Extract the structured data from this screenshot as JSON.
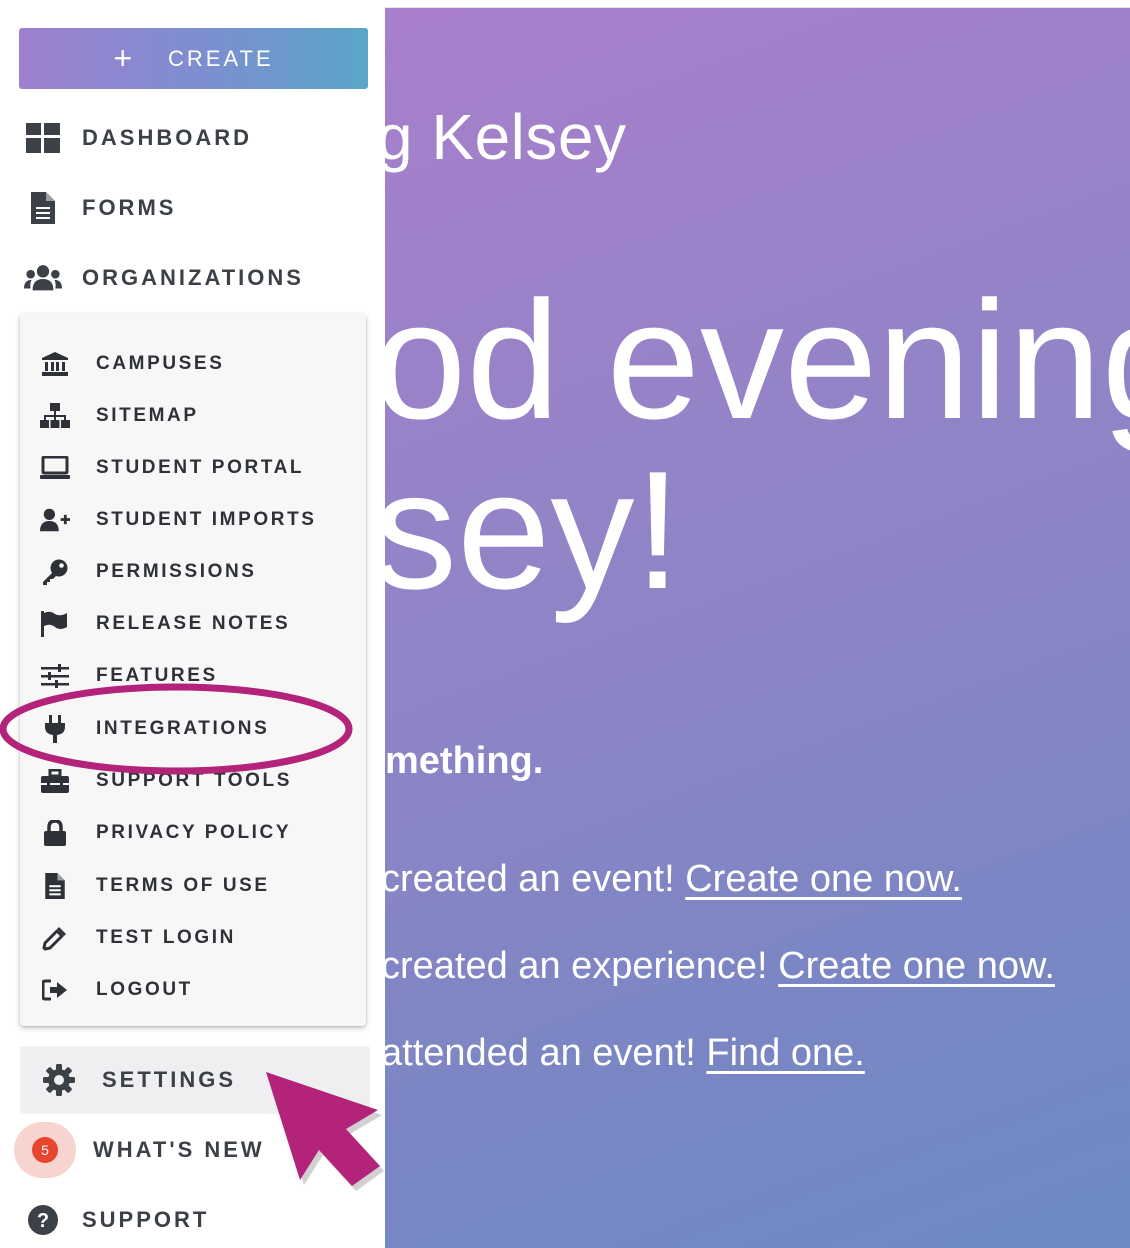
{
  "main": {
    "greeting_small": "g Kelsey",
    "greeting_big_line1": "od evening,",
    "greeting_big_line2": "sey!",
    "prompt": "mething.",
    "lines": [
      {
        "text": "created an event! ",
        "link": "Create one now."
      },
      {
        "text": "created an experience! ",
        "link": "Create one now."
      },
      {
        "text": "attended an event! ",
        "link": "Find one."
      }
    ]
  },
  "sidebar": {
    "create_label": "CREATE",
    "create_icon": "plus-icon",
    "top_items": [
      {
        "label": "DASHBOARD",
        "icon": "dashboard-icon"
      },
      {
        "label": "FORMS",
        "icon": "document-icon"
      },
      {
        "label": "ORGANIZATIONS",
        "icon": "users-icon"
      }
    ],
    "submenu": [
      {
        "label": "CAMPUSES",
        "icon": "university-icon"
      },
      {
        "label": "SITEMAP",
        "icon": "sitemap-icon"
      },
      {
        "label": "STUDENT PORTAL",
        "icon": "laptop-icon"
      },
      {
        "label": "STUDENT IMPORTS",
        "icon": "user-plus-icon"
      },
      {
        "label": "PERMISSIONS",
        "icon": "key-icon"
      },
      {
        "label": "RELEASE NOTES",
        "icon": "flag-icon"
      },
      {
        "label": "FEATURES",
        "icon": "sliders-icon"
      },
      {
        "label": "INTEGRATIONS",
        "icon": "plug-icon"
      },
      {
        "label": "SUPPORT TOOLS",
        "icon": "toolbox-icon"
      },
      {
        "label": "PRIVACY POLICY",
        "icon": "lock-icon"
      },
      {
        "label": "TERMS OF USE",
        "icon": "document-icon"
      },
      {
        "label": "TEST LOGIN",
        "icon": "eyedropper-icon"
      },
      {
        "label": "LOGOUT",
        "icon": "sign-out-icon"
      }
    ],
    "bottom_items": [
      {
        "label": "SETTINGS",
        "icon": "gear-icon"
      },
      {
        "label": "WHAT'S NEW",
        "icon": "notification-badge",
        "badge": "5"
      },
      {
        "label": "SUPPORT",
        "icon": "question-circle-icon"
      }
    ]
  },
  "colors": {
    "accent_gradient_start": "#a07fd0",
    "accent_gradient_end": "#5aa6c8",
    "annotation": "#b3237a",
    "badge": "#e8452f",
    "text_dark": "#3c4148"
  }
}
